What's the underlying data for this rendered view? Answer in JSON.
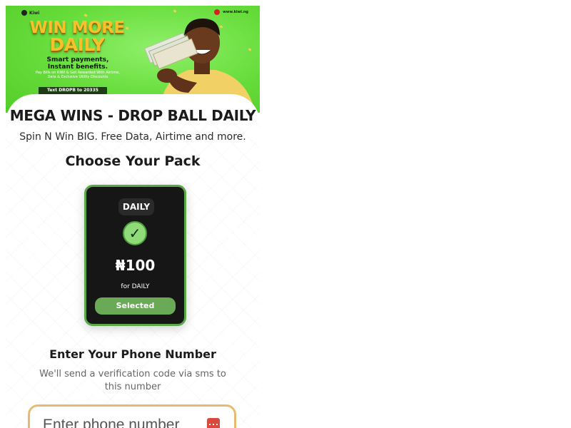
{
  "banner": {
    "logo_text": "Kiwi",
    "url_text": "www.kiwi.ng",
    "headline_line1": "WIN MORE",
    "headline_line2": "DAILY",
    "subhead": "Smart payments, Instant benefits.",
    "small_text": "Pay Bills on KIWI & Get Rewarded With Airtime, Data & Exclusive Utility Discounts",
    "cta_text": "Text DROPB to 20335",
    "colors": {
      "background": "#66dc3a",
      "headline": "#f6c129"
    }
  },
  "page": {
    "title": "MEGA WINS - DROP BALL DAILY",
    "subtitle": "Spin N Win BIG. Free Data, Airtime and more.",
    "pack_heading": "Choose Your Pack"
  },
  "pack": {
    "tag": "DAILY",
    "check_symbol": "✓",
    "price": "₦100",
    "period": "for DAILY",
    "button_label": "Selected",
    "colors": {
      "card": "#161616",
      "accent": "#5aa84a"
    }
  },
  "phone": {
    "heading": "Enter Your Phone Number",
    "description": "We'll send a verification code via sms to this number",
    "placeholder": "Enter phone number",
    "icon": "phone-keypad-icon",
    "colors": {
      "border": "#e7bb6f",
      "icon": "#d9493e"
    }
  }
}
